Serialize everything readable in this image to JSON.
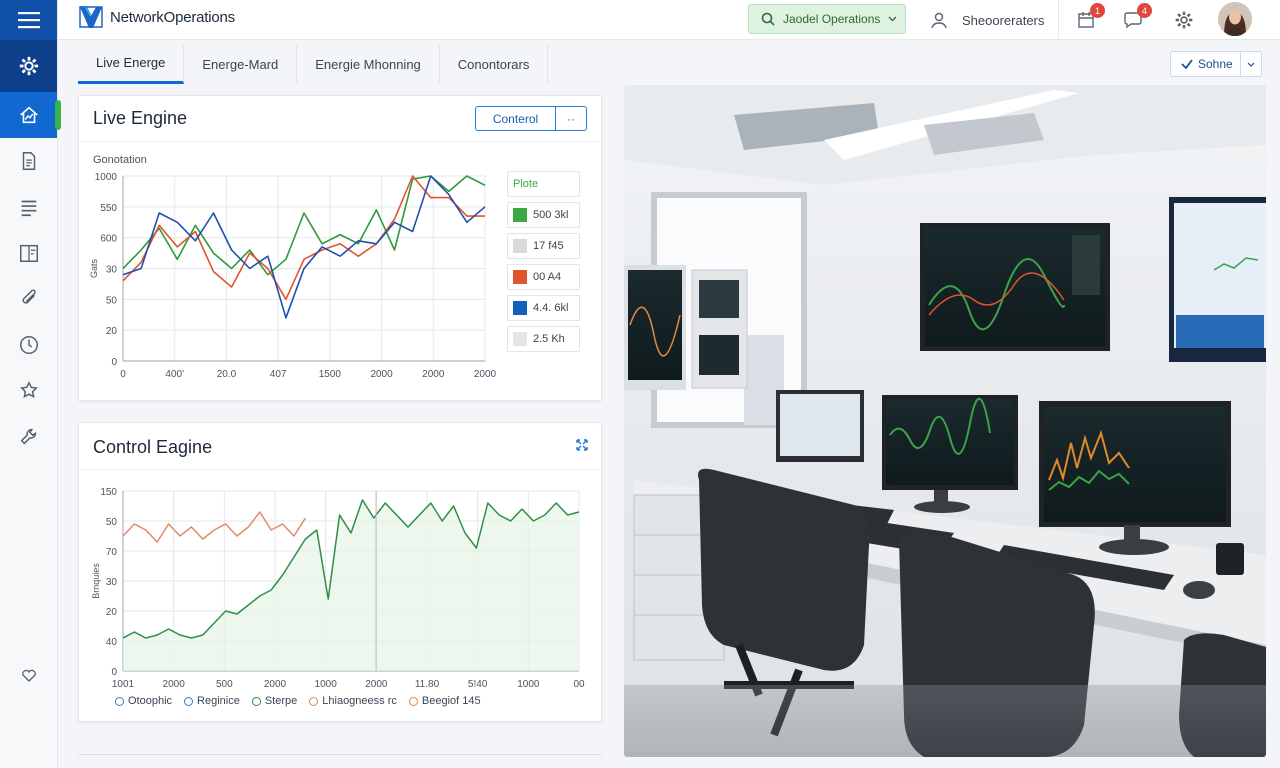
{
  "brand": {
    "name": "NetworkOperations"
  },
  "topbar": {
    "status_label": "Jaodel Operations",
    "user_label": "Sheooreraters",
    "notif_badge_1": "1",
    "notif_badge_2": "4"
  },
  "tabs": [
    {
      "label": "Live Energe"
    },
    {
      "label": "Energe-Mard"
    },
    {
      "label": "Energie Mhonning"
    },
    {
      "label": "Conontorars"
    }
  ],
  "share": {
    "label": "Sohne"
  },
  "live_card": {
    "title": "Live Engine",
    "control_label": "Conterol",
    "control_more": "··",
    "subtitle": "Gonotation",
    "legend": [
      {
        "label": "Plote",
        "color": ""
      },
      {
        "label": "500 3kl",
        "color": "#3aa845"
      },
      {
        "label": "17 f45",
        "color": "#d9dadc"
      },
      {
        "label": "00 A4",
        "color": "#e2542e"
      },
      {
        "label": "4.4. 6kl",
        "color": "#1560bd"
      },
      {
        "label": "2.5 Kh",
        "color": "#e3e4e6"
      }
    ]
  },
  "control_card": {
    "title": "Control Eagine",
    "expand_icon": "expand-icon",
    "legend": [
      {
        "label": "Otoophic"
      },
      {
        "label": "Reginice"
      },
      {
        "label": "Sterpe"
      },
      {
        "label": "Lhiaogneess rc"
      },
      {
        "label": "Beegiof 145"
      }
    ]
  },
  "chart_data": [
    {
      "type": "line",
      "title": "Live Engine",
      "subtitle": "Gonotation",
      "x_tick_labels": [
        "0",
        "400'",
        "20.0",
        "407",
        "1500",
        "2000",
        "2000",
        "2000"
      ],
      "y_tick_labels": [
        "0",
        "20",
        "50",
        "30",
        "600",
        "550",
        "1000"
      ],
      "y_label": "Gats",
      "ylim": [
        0,
        6
      ],
      "grid": true,
      "series": [
        {
          "color": "#2f9a3a",
          "values": [
            3.0,
            3.6,
            4.3,
            3.3,
            4.4,
            3.5,
            3.0,
            3.6,
            2.8,
            3.3,
            4.8,
            3.8,
            4.1,
            3.8,
            4.9,
            3.6,
            5.9,
            6.0,
            5.5,
            6.3,
            5.7
          ]
        },
        {
          "color": "#e2542e",
          "values": [
            2.6,
            3.2,
            4.4,
            3.7,
            4.2,
            2.9,
            2.4,
            3.5,
            3.0,
            2.0,
            3.3,
            3.6,
            3.8,
            3.4,
            3.8,
            4.6,
            6.0,
            5.3,
            5.3,
            4.7,
            4.7
          ]
        },
        {
          "color": "#1f4fb0",
          "values": [
            2.8,
            3.0,
            4.8,
            4.5,
            3.9,
            4.8,
            3.6,
            3.0,
            3.4,
            1.4,
            3.0,
            3.7,
            3.4,
            3.9,
            3.8,
            4.5,
            4.2,
            7.7,
            5.4,
            4.5,
            5.0
          ]
        }
      ]
    },
    {
      "type": "area",
      "title": "Control Eagine",
      "x_tick_labels": [
        "1001",
        "2000",
        "500",
        "2000",
        "1000",
        "2000",
        "11.80",
        "5!40",
        "1000",
        "00"
      ],
      "y_tick_labels": [
        "0",
        "40",
        "20",
        "30",
        "70",
        "50",
        "150"
      ],
      "y_label": "Brnquies",
      "ylim": [
        0,
        6
      ],
      "grid": true,
      "series": [
        {
          "color": "#2f8f45",
          "values": [
            1.1,
            1.3,
            1.1,
            1.2,
            1.4,
            1.2,
            1.1,
            1.2,
            1.6,
            2.0,
            1.9,
            2.2,
            2.5,
            2.7,
            3.2,
            3.8,
            4.4,
            4.7,
            2.4,
            5.2,
            4.6,
            5.7,
            5.1,
            5.6,
            5.2,
            4.8,
            5.2,
            5.6,
            5.0,
            5.5,
            4.6,
            4.1,
            5.6,
            5.2,
            5.0,
            5.4,
            5.0,
            5.2,
            5.6,
            5.2,
            5.3
          ]
        },
        {
          "color": "#e08a6a",
          "values": [
            4.5,
            4.9,
            4.7,
            4.3,
            4.9,
            4.5,
            4.8,
            4.4,
            4.7,
            4.9,
            4.5,
            4.8,
            5.3,
            4.7,
            4.9,
            4.5,
            5.1
          ]
        }
      ]
    }
  ]
}
